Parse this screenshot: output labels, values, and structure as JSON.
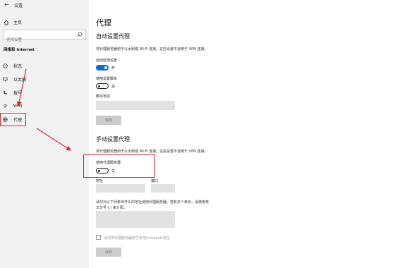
{
  "titlebar": {
    "back_icon": "back-arrow-icon",
    "title": "设置"
  },
  "sidebar": {
    "home_label": "主页",
    "search_placeholder": "查找设置",
    "section": "网络和 Internet",
    "items": [
      {
        "label": "状态",
        "icon": "status-globe-icon"
      },
      {
        "label": "以太网",
        "icon": "ethernet-icon"
      },
      {
        "label": "拨号",
        "icon": "dialup-icon"
      },
      {
        "label": "VPN",
        "icon": "vpn-icon"
      },
      {
        "label": "代理",
        "icon": "globe-icon",
        "active": true
      }
    ]
  },
  "page": {
    "title": "代理",
    "auto": {
      "heading": "自动设置代理",
      "desc": "将代理服务器用于以太网或 Wi-Fi 连接。这些设置不适用于 VPN 连接。",
      "detect_label": "自动检测设置",
      "detect_state": "开",
      "script_label": "使用设置脚本",
      "script_state": "关",
      "address_label": "脚本地址",
      "save": "保存"
    },
    "manual": {
      "heading": "手动设置代理",
      "desc": "将代理服务器用于以太网或 Wi-Fi 连接。这些设置不适用于 VPN 连接。",
      "use_proxy_label": "使用代理服务器",
      "use_proxy_state": "关",
      "address_label": "地址",
      "port_label": "端口",
      "exceptions_desc_line1": "请勿对以下列条目开头的地址使用代理服务器。若有多个条目，请使用英",
      "exceptions_desc_line2": "文分号 (;) 来分隔。",
      "local_checkbox_label": "请勿将代理服务器用于本地(Intranet)地址",
      "save": "保存"
    }
  },
  "colors": {
    "accent": "#0b6ec9",
    "annotation": "#e0252f",
    "sidebar_bg": "#f2f2f2"
  }
}
